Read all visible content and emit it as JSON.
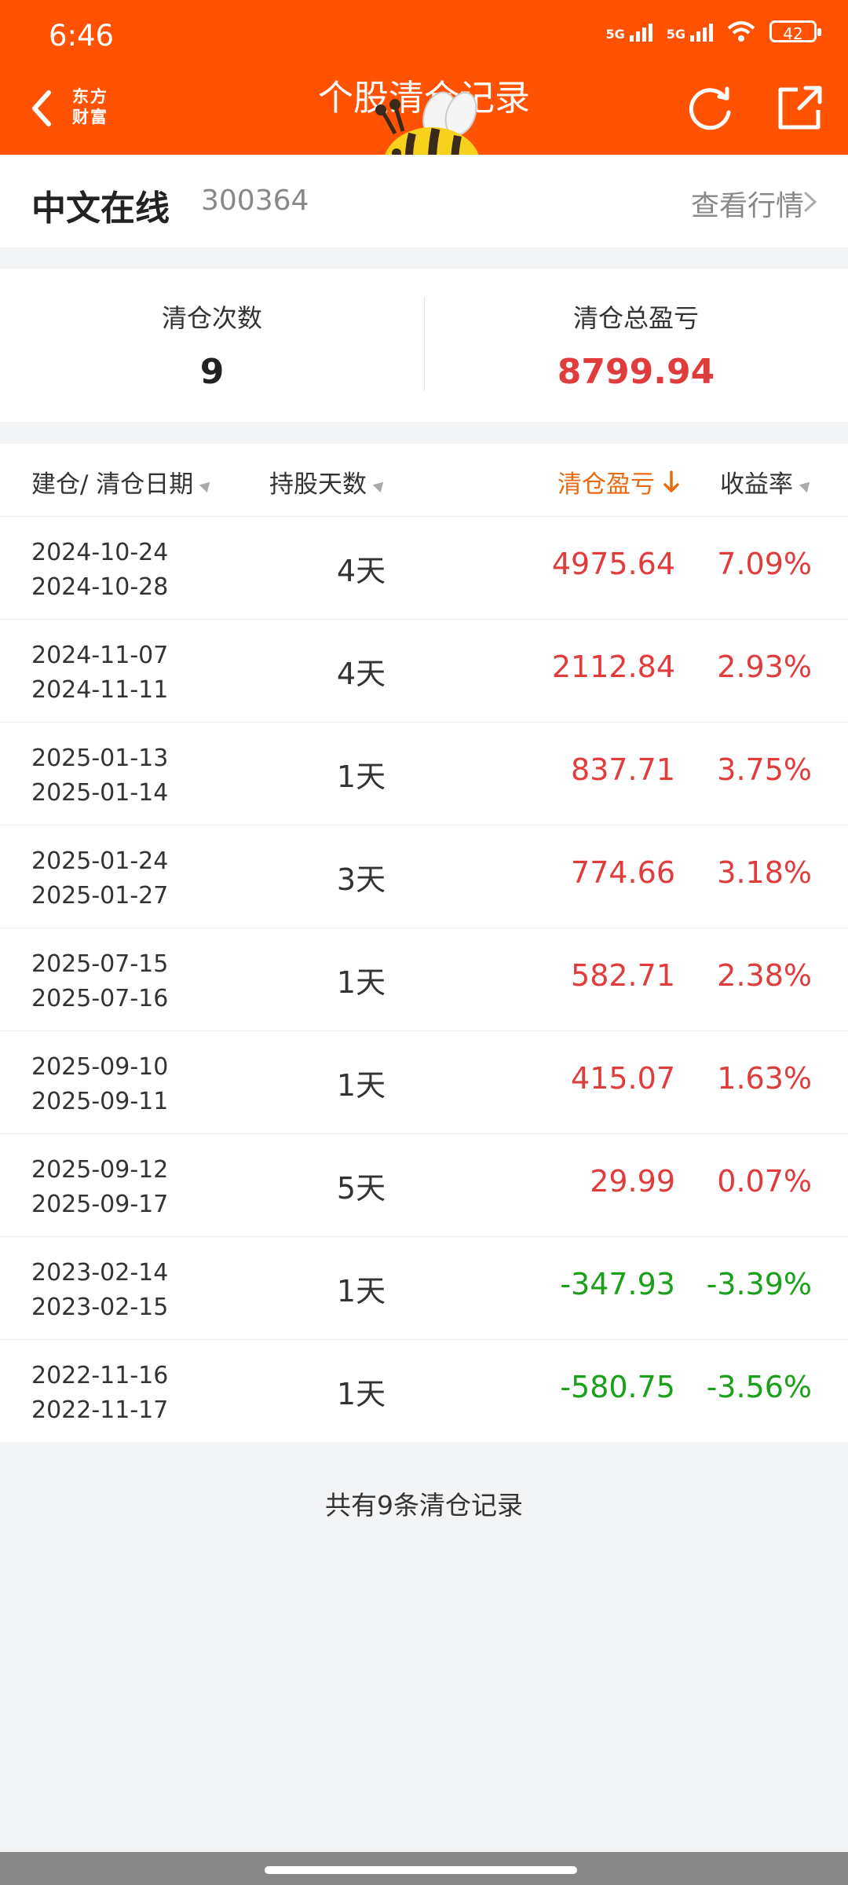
{
  "status_bar": {
    "time": "6:46",
    "battery": "42",
    "signal1": "5G",
    "signal2": "5G"
  },
  "header": {
    "logo_line1": "东方",
    "logo_line2": "财富",
    "title": "个股清仓记录"
  },
  "stock": {
    "name": "中文在线",
    "code": "300364",
    "market_link": "查看行情"
  },
  "summary": {
    "count_label": "清仓次数",
    "count_value": "9",
    "total_label": "清仓总盈亏",
    "total_value": "8799.94"
  },
  "table": {
    "headers": {
      "date": "建仓/ 清仓日期",
      "days": "持股天数",
      "pl": "清仓盈亏",
      "rate": "收益率"
    },
    "rows": [
      {
        "open": "2024-10-24",
        "close": "2024-10-28",
        "days": "4天",
        "pl": "4975.64",
        "rate": "7.09%",
        "sign": "pos"
      },
      {
        "open": "2024-11-07",
        "close": "2024-11-11",
        "days": "4天",
        "pl": "2112.84",
        "rate": "2.93%",
        "sign": "pos"
      },
      {
        "open": "2025-01-13",
        "close": "2025-01-14",
        "days": "1天",
        "pl": "837.71",
        "rate": "3.75%",
        "sign": "pos"
      },
      {
        "open": "2025-01-24",
        "close": "2025-01-27",
        "days": "3天",
        "pl": "774.66",
        "rate": "3.18%",
        "sign": "pos"
      },
      {
        "open": "2025-07-15",
        "close": "2025-07-16",
        "days": "1天",
        "pl": "582.71",
        "rate": "2.38%",
        "sign": "pos"
      },
      {
        "open": "2025-09-10",
        "close": "2025-09-11",
        "days": "1天",
        "pl": "415.07",
        "rate": "1.63%",
        "sign": "pos"
      },
      {
        "open": "2025-09-12",
        "close": "2025-09-17",
        "days": "5天",
        "pl": "29.99",
        "rate": "0.07%",
        "sign": "pos"
      },
      {
        "open": "2023-02-14",
        "close": "2023-02-15",
        "days": "1天",
        "pl": "-347.93",
        "rate": "-3.39%",
        "sign": "neg"
      },
      {
        "open": "2022-11-16",
        "close": "2022-11-17",
        "days": "1天",
        "pl": "-580.75",
        "rate": "-3.56%",
        "sign": "neg"
      }
    ]
  },
  "footer": {
    "text": "共有9条清仓记录"
  },
  "colors": {
    "brand": "#ff5303",
    "profit": "#e03c3c",
    "loss": "#1aa01a",
    "active_sort": "#e86a10"
  }
}
